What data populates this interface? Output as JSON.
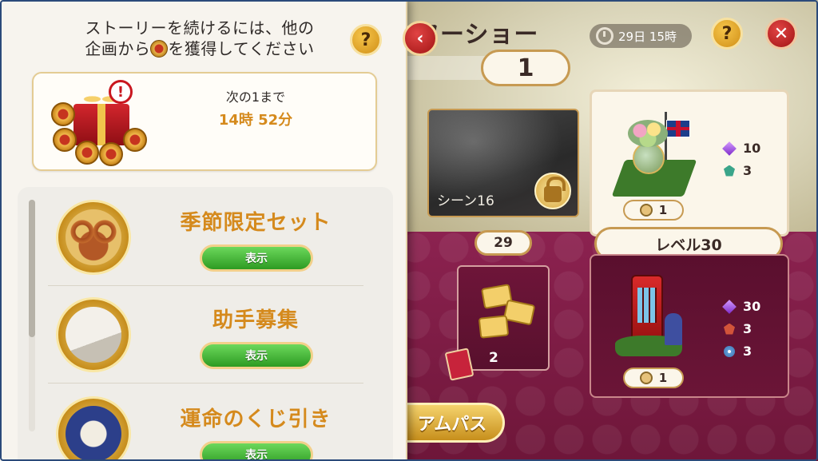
{
  "background_event": {
    "title_partial": "ワーショー",
    "level_value": "1",
    "timer": "29日 15時",
    "scene": {
      "label": "シーン16"
    },
    "reward_top": {
      "gems": "10",
      "rank": "3",
      "count": "1"
    },
    "level29_label": "29",
    "level30_label": "レベル30",
    "reward_bottom": {
      "gems": "30",
      "rank": "3",
      "compass": "3",
      "count": "1"
    },
    "tickets_count": "2",
    "pass_button": "アムパス"
  },
  "panel": {
    "header_line1": "ストーリーを続けるには、他の",
    "header_line2_pre": "企画から",
    "header_line2_post": "を獲得してください",
    "help_label": "?",
    "collapse_label": "‹",
    "timer_card": {
      "until_text": "次の1まで",
      "countdown": "14時 52分",
      "alert": "!"
    },
    "items": [
      {
        "title": "季節限定セット",
        "button": "表示",
        "icon": "pretzel-icon"
      },
      {
        "title": "助手募集",
        "button": "表示",
        "icon": "papers-icon"
      },
      {
        "title": "運命のくじ引き",
        "button": "表示",
        "icon": "lottery-icon"
      }
    ],
    "scroll_position": 0.0
  },
  "colors": {
    "accent_orange": "#d58a1d",
    "green_button": "#2d9b22",
    "red_close": "#a11414",
    "gold_help": "#d08f17"
  }
}
